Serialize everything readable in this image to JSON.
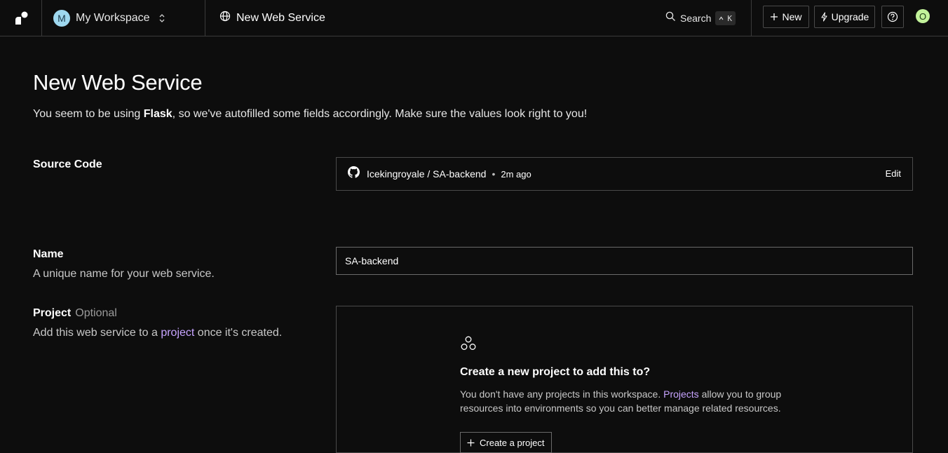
{
  "header": {
    "workspace_initial": "M",
    "workspace_name": "My Workspace",
    "page_title": "New Web Service",
    "search_label": "Search",
    "search_shortcut": "K",
    "new_label": "New",
    "upgrade_label": "Upgrade",
    "user_initial": "O"
  },
  "main": {
    "title": "New Web Service",
    "intro_before": "You seem to be using ",
    "intro_framework": "Flask",
    "intro_after": ", so we've autofilled some fields accordingly. Make sure the values look right to you!"
  },
  "source_code": {
    "label": "Source Code",
    "repo": "Icekingroyale / SA-backend",
    "separator": "•",
    "updated": "2m ago",
    "edit_label": "Edit"
  },
  "name_field": {
    "label": "Name",
    "description": "A unique name for your web service.",
    "value": "SA-backend"
  },
  "project": {
    "label": "Project",
    "optional": "Optional",
    "desc_before": "Add this web service to a ",
    "desc_link": "project",
    "desc_after": " once it's created.",
    "empty_title": "Create a new project to add this to?",
    "empty_desc_before": "You don't have any projects in this workspace. ",
    "empty_desc_link": "Projects",
    "empty_desc_after": " allow you to group resources into environments so you can better manage related resources.",
    "create_label": "Create a project"
  },
  "colors": {
    "background": "#0d0d0d",
    "border": "#3a3a3a",
    "link": "#c7a4ff",
    "workspace_avatar": "#9fd8ef",
    "user_avatar": "#c2f29a"
  }
}
